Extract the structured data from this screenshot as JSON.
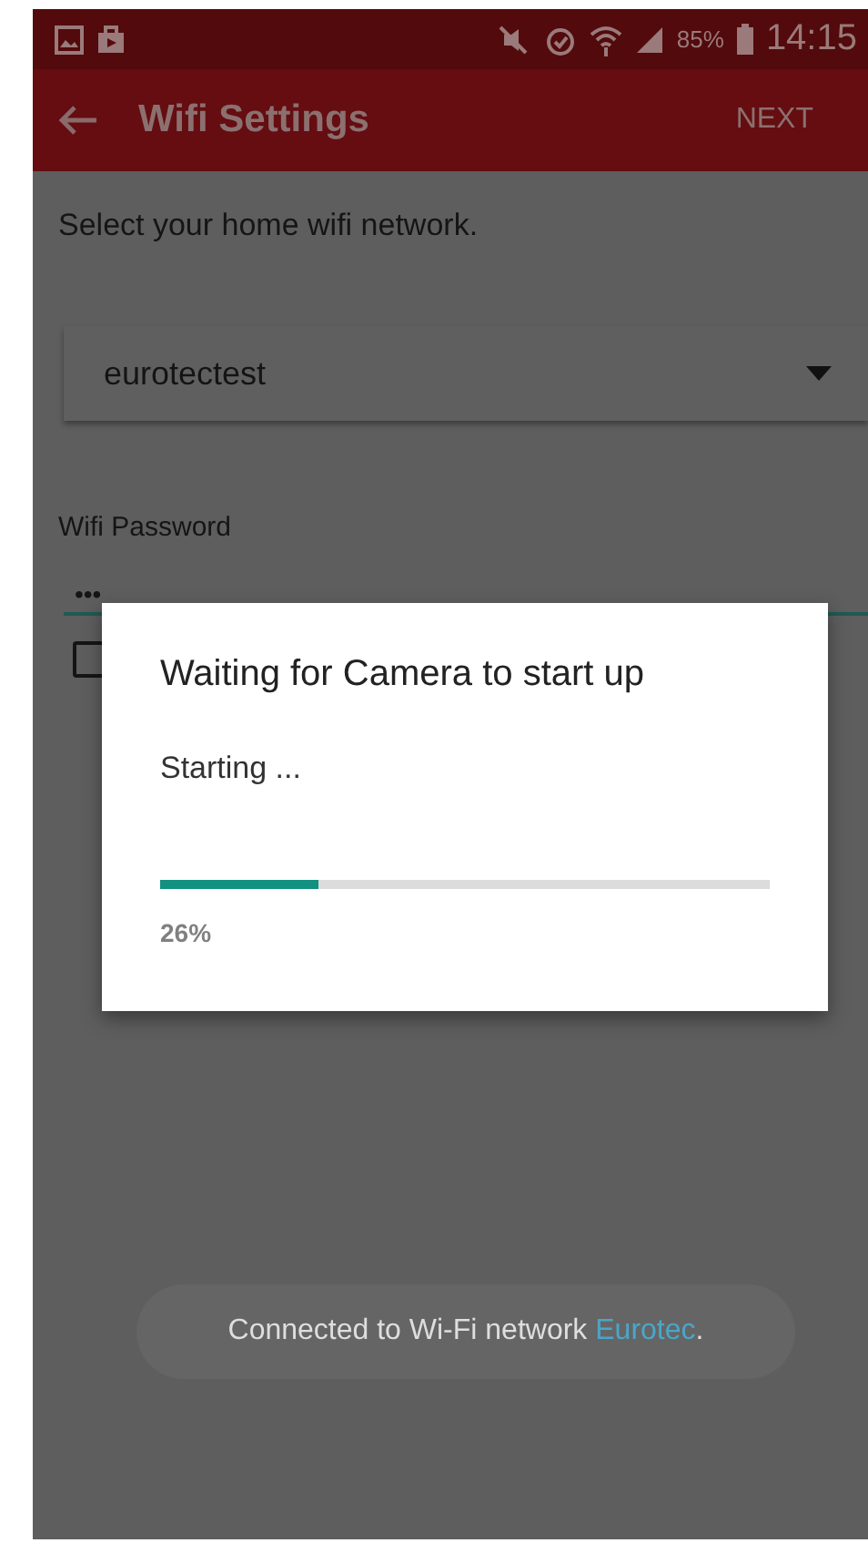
{
  "status_bar": {
    "battery": "85%",
    "time": "14:15"
  },
  "app_bar": {
    "title": "Wifi Settings",
    "action": "NEXT"
  },
  "form": {
    "instruction": "Select your home wifi network.",
    "network_dropdown": {
      "value": "eurotectest"
    },
    "password": {
      "label": "Wifi Password",
      "value": "•••"
    },
    "show_password_checkbox": {
      "checked": false
    }
  },
  "dialog": {
    "title": "Waiting for Camera to start up",
    "message": "Starting ...",
    "progress": {
      "level": 0.26,
      "reading": "26%"
    }
  },
  "toast": {
    "message": "Connected to Wi-Fi network",
    "network_name": "Eurotec",
    "suffix": "."
  }
}
